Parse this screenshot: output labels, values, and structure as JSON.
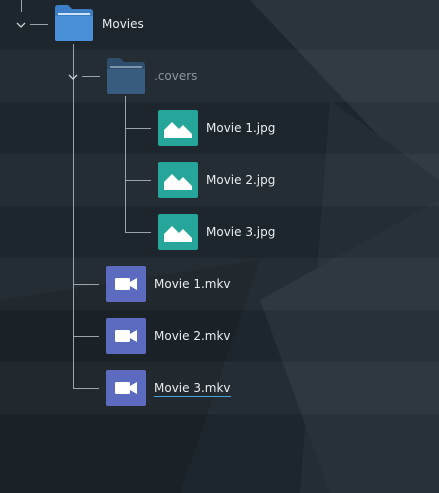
{
  "tree": {
    "root_folder": {
      "label": "Movies",
      "icon": "folder-icon"
    },
    "covers_folder": {
      "label": ".covers",
      "icon": "folder-icon"
    },
    "images": [
      {
        "label": "Movie 1.jpg",
        "icon": "image-icon"
      },
      {
        "label": "Movie 2.jpg",
        "icon": "image-icon"
      },
      {
        "label": "Movie 3.jpg",
        "icon": "image-icon"
      }
    ],
    "videos": [
      {
        "label": "Movie 1.mkv",
        "icon": "video-icon"
      },
      {
        "label": "Movie 2.mkv",
        "icon": "video-icon"
      },
      {
        "label": "Movie 3.mkv",
        "icon": "video-icon"
      }
    ]
  },
  "colors": {
    "background": "#1d262c",
    "folder": "#4a90d9",
    "image_tile": "#26a69a",
    "video_tile": "#5c6bc0",
    "hover_underline": "#4aa3d8"
  }
}
